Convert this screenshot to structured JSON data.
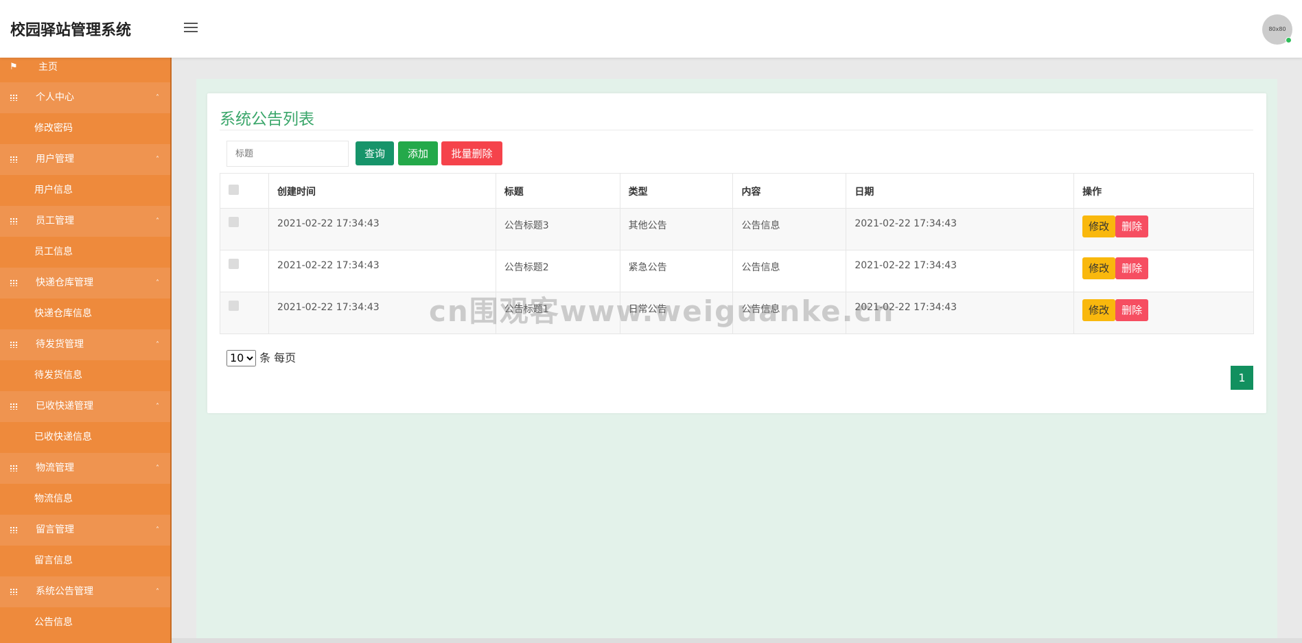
{
  "header": {
    "title": "校园驿站管理系统",
    "avatar_text": "80x80"
  },
  "sidebar": {
    "home": "主页",
    "groups": [
      {
        "label": "个人中心",
        "sub": "修改密码"
      },
      {
        "label": "用户管理",
        "sub": "用户信息"
      },
      {
        "label": "员工管理",
        "sub": "员工信息"
      },
      {
        "label": "快递仓库管理",
        "sub": "快递仓库信息"
      },
      {
        "label": "待发货管理",
        "sub": "待发货信息"
      },
      {
        "label": "已收快递管理",
        "sub": "已收快递信息"
      },
      {
        "label": "物流管理",
        "sub": "物流信息"
      },
      {
        "label": "留言管理",
        "sub": "留言信息"
      },
      {
        "label": "系统公告管理",
        "sub": "公告信息"
      }
    ]
  },
  "main": {
    "title": "系统公告列表",
    "search_placeholder": "标题",
    "buttons": {
      "query": "查询",
      "add": "添加",
      "batch_delete": "批量删除"
    },
    "columns": [
      "创建时间",
      "标题",
      "类型",
      "内容",
      "日期",
      "操作"
    ],
    "rows": [
      {
        "created": "2021-02-22 17:34:43",
        "title": "公告标题3",
        "type": "其他公告",
        "content": "公告信息",
        "date": "2021-02-22 17:34:43"
      },
      {
        "created": "2021-02-22 17:34:43",
        "title": "公告标题2",
        "type": "紧急公告",
        "content": "公告信息",
        "date": "2021-02-22 17:34:43"
      },
      {
        "created": "2021-02-22 17:34:43",
        "title": "公告标题1",
        "type": "日常公告",
        "content": "公告信息",
        "date": "2021-02-22 17:34:43"
      }
    ],
    "row_actions": {
      "edit": "修改",
      "delete": "删除"
    },
    "page_size": {
      "value": "10",
      "suffix": "条 每页"
    },
    "current_page": "1"
  },
  "watermark": "cn围观客www.weiguanke.cn",
  "colors": {
    "sidebar": "#ee8a3c",
    "accent": "#3aa66a",
    "danger": "#f5434b",
    "warning": "#f9b80d"
  }
}
